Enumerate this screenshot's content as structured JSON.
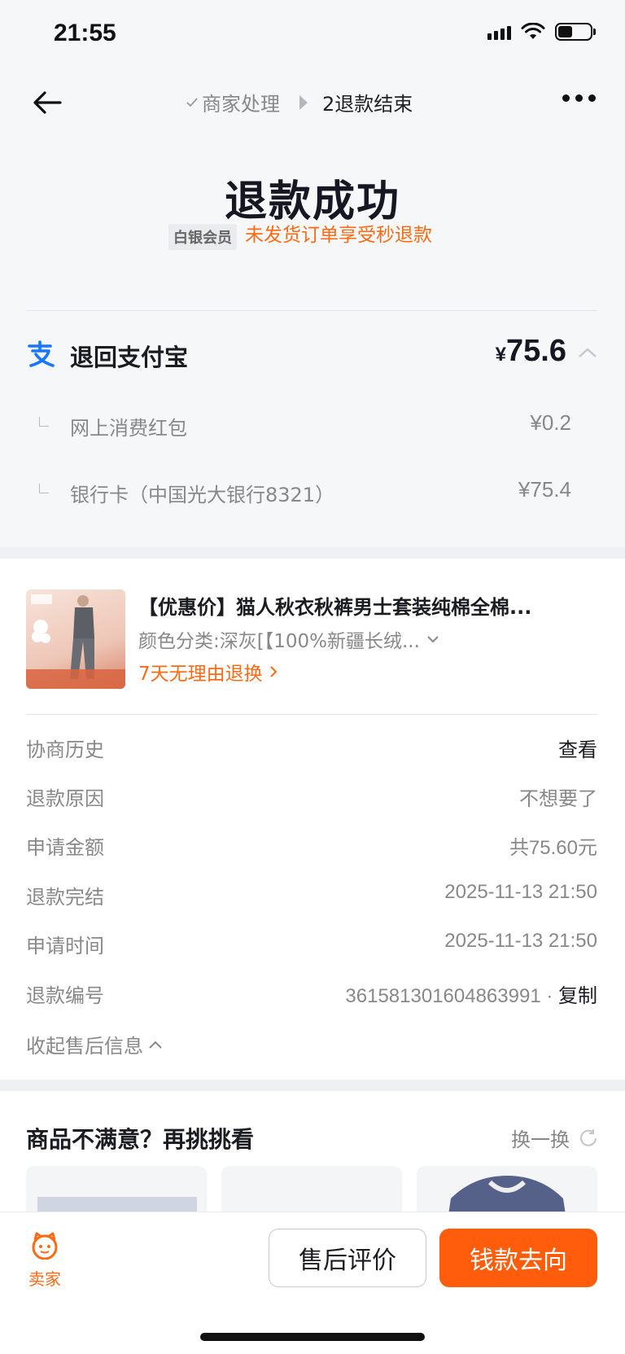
{
  "status_bar": {
    "time": "21:55"
  },
  "nav": {
    "step1": "商家处理",
    "step2": "2退款结束"
  },
  "result": {
    "title": "退款成功",
    "member_badge": "白银会员",
    "member_benefit": "未发货订单享受秒退款"
  },
  "refund": {
    "label": "退回支付宝",
    "currency": "¥",
    "total": "75.6",
    "items": [
      {
        "label": "网上消费红包",
        "amount": "¥0.2"
      },
      {
        "label": "银行卡（中国光大银行8321）",
        "amount": "¥75.4"
      }
    ]
  },
  "product": {
    "title": "【优惠价】猫人秋衣秋裤男士套装纯棉全棉...",
    "variant": "颜色分类:深灰[【100%新疆长绒...",
    "return_policy": "7天无理由退换"
  },
  "details": [
    {
      "key": "协商历史",
      "value": "查看"
    },
    {
      "key": "退款原因",
      "value": "不想要了"
    },
    {
      "key": "申请金额",
      "value": "共75.60元"
    },
    {
      "key": "退款完结",
      "value": "2025-11-13 21:50"
    },
    {
      "key": "申请时间",
      "value": "2025-11-13 21:50"
    },
    {
      "key": "退款编号",
      "value": "3615813016048639​91",
      "copy": "复制"
    }
  ],
  "collapse_label": "收起售后信息",
  "recommend": {
    "title": "商品不满意？再挑挑看",
    "refresh": "换一换"
  },
  "bottom": {
    "seller": "卖家",
    "review": "售后评价",
    "money_flow": "钱款去向"
  },
  "colors": {
    "accent": "#ff5d0c",
    "orange_text": "#ff6a13",
    "alipay": "#1677ff"
  }
}
